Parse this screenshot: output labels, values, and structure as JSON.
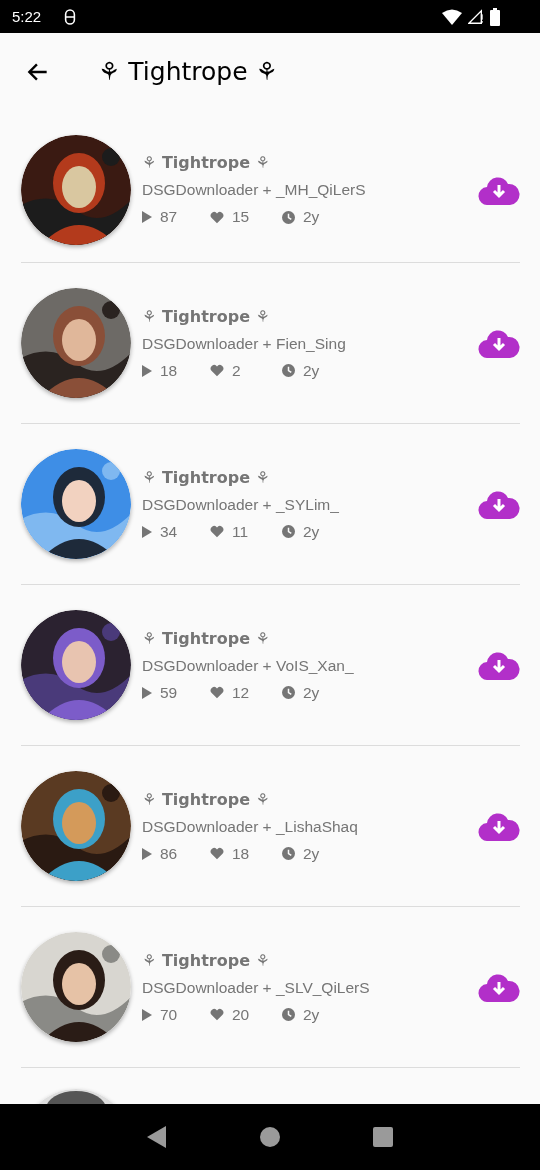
{
  "status_bar": {
    "time": "5:22"
  },
  "app_bar": {
    "title": "⚘ Tightrope ⚘"
  },
  "items": [
    {
      "kind": "track",
      "title": "⚘ Tightrope ⚘",
      "subtitle": "DSGDownloader + _MH_QiLerS",
      "plays": "87",
      "likes": "15",
      "age": "2y"
    },
    {
      "kind": "track",
      "title": "⚘ Tightrope ⚘",
      "subtitle": "DSGDownloader + Fien_Sing",
      "plays": "18",
      "likes": "2",
      "age": "2y"
    },
    {
      "kind": "track",
      "title": "⚘ Tightrope ⚘",
      "subtitle": "DSGDownloader + _SYLim_",
      "plays": "34",
      "likes": "11",
      "age": "2y"
    },
    {
      "kind": "track",
      "title": "⚘ Tightrope ⚘",
      "subtitle": "DSGDownloader + VoIS_Xan_",
      "plays": "59",
      "likes": "12",
      "age": "2y"
    },
    {
      "kind": "track",
      "title": "⚘ Tightrope ⚘",
      "subtitle": "DSGDownloader + _LishaShaq",
      "plays": "86",
      "likes": "18",
      "age": "2y"
    },
    {
      "kind": "track",
      "title": "⚘ Tightrope ⚘",
      "subtitle": "DSGDownloader + _SLV_QiLerS",
      "plays": "70",
      "likes": "20",
      "age": "2y"
    },
    {
      "kind": "partial"
    }
  ]
}
